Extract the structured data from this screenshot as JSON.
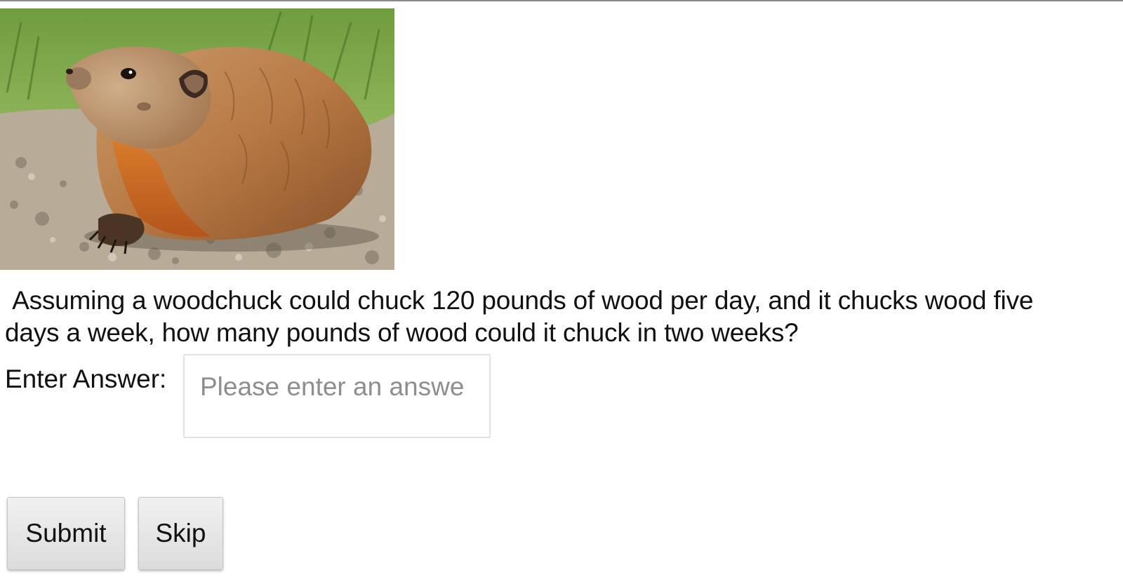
{
  "image": {
    "subject": "woodchuck photo"
  },
  "question": {
    "text": " Assuming a woodchuck could chuck 120 pounds of wood per day, and it chucks wood five\ndays a week, how many pounds of wood could it chuck in two weeks?"
  },
  "answer": {
    "label": "Enter Answer:",
    "value": "",
    "placeholder": "Please enter an answe"
  },
  "buttons": {
    "submit_label": "Submit",
    "skip_label": "Skip"
  },
  "colors": {
    "button_bg": "#e6e6e6",
    "input_border": "#e2e2e2",
    "placeholder": "#8e8e8e"
  }
}
